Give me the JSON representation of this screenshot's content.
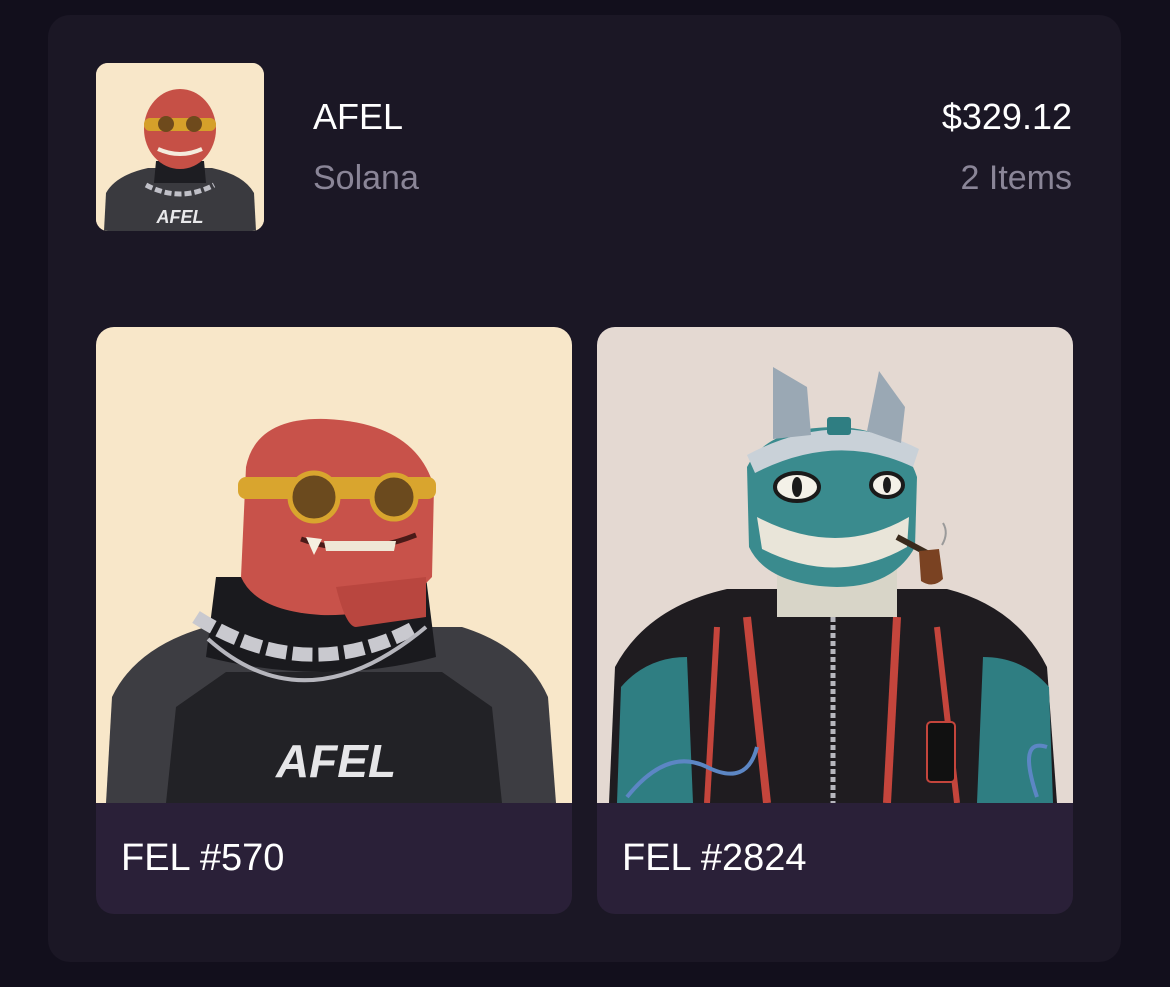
{
  "collection": {
    "name": "AFEL",
    "chain": "Solana",
    "total_value": "$329.12",
    "items_count": "2 Items",
    "thumbnail_bg": "#f8e7c9"
  },
  "nfts": [
    {
      "name": "FEL #570",
      "bg": "#f8e7c9"
    },
    {
      "name": "FEL #2824",
      "bg": "#e4d9d2"
    }
  ],
  "logo_text": "AFEL"
}
